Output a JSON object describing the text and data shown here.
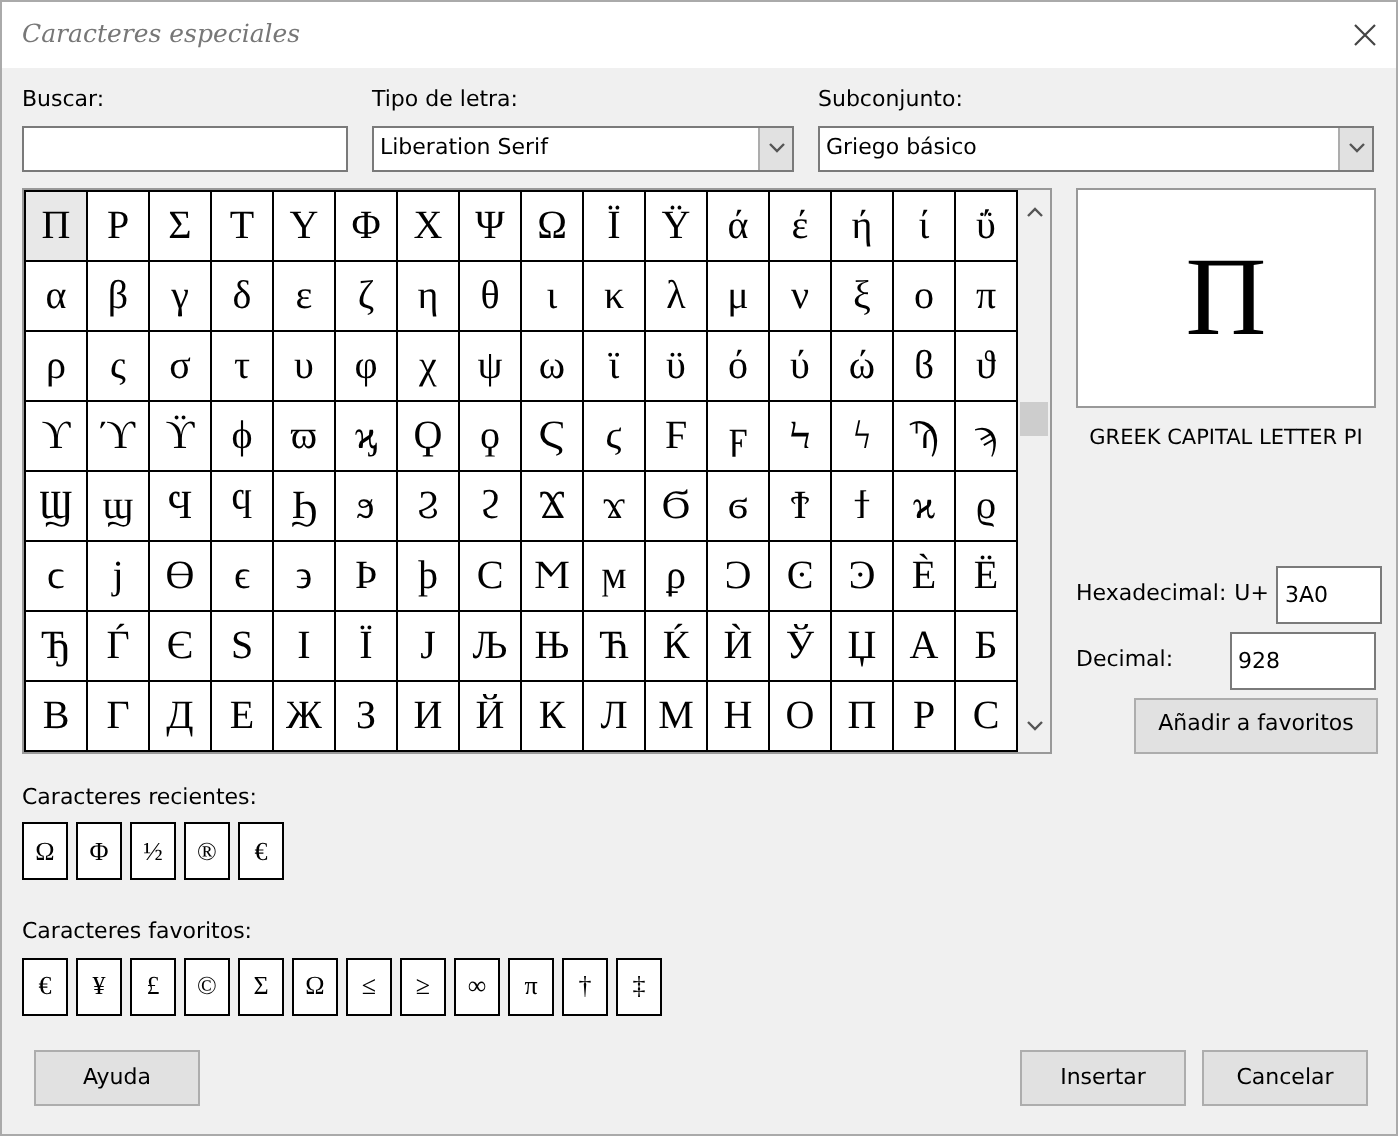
{
  "window": {
    "title": "Caracteres especiales"
  },
  "search": {
    "label": "Buscar:"
  },
  "font": {
    "label": "Tipo de letra:",
    "value": "Liberation Serif"
  },
  "subset": {
    "label": "Subconjunto:",
    "value": "Griego básico"
  },
  "grid": [
    [
      {
        "char": "Π",
        "selected": true
      },
      {
        "char": "Ρ",
        "selected": false
      },
      {
        "char": "Σ",
        "selected": false
      },
      {
        "char": "Τ",
        "selected": false
      },
      {
        "char": "Υ",
        "selected": false
      },
      {
        "char": "Φ",
        "selected": false
      },
      {
        "char": "Χ",
        "selected": false
      },
      {
        "char": "Ψ",
        "selected": false
      },
      {
        "char": "Ω",
        "selected": false
      },
      {
        "char": "Ϊ",
        "selected": false
      },
      {
        "char": "Ϋ",
        "selected": false
      },
      {
        "char": "ά",
        "selected": false
      },
      {
        "char": "έ",
        "selected": false
      },
      {
        "char": "ή",
        "selected": false
      },
      {
        "char": "ί",
        "selected": false
      },
      {
        "char": "ΰ",
        "selected": false
      }
    ],
    [
      {
        "char": "α",
        "selected": false
      },
      {
        "char": "β",
        "selected": false
      },
      {
        "char": "γ",
        "selected": false
      },
      {
        "char": "δ",
        "selected": false
      },
      {
        "char": "ε",
        "selected": false
      },
      {
        "char": "ζ",
        "selected": false
      },
      {
        "char": "η",
        "selected": false
      },
      {
        "char": "θ",
        "selected": false
      },
      {
        "char": "ι",
        "selected": false
      },
      {
        "char": "κ",
        "selected": false
      },
      {
        "char": "λ",
        "selected": false
      },
      {
        "char": "μ",
        "selected": false
      },
      {
        "char": "ν",
        "selected": false
      },
      {
        "char": "ξ",
        "selected": false
      },
      {
        "char": "ο",
        "selected": false
      },
      {
        "char": "π",
        "selected": false
      }
    ],
    [
      {
        "char": "ρ",
        "selected": false
      },
      {
        "char": "ς",
        "selected": false
      },
      {
        "char": "σ",
        "selected": false
      },
      {
        "char": "τ",
        "selected": false
      },
      {
        "char": "υ",
        "selected": false
      },
      {
        "char": "φ",
        "selected": false
      },
      {
        "char": "χ",
        "selected": false
      },
      {
        "char": "ψ",
        "selected": false
      },
      {
        "char": "ω",
        "selected": false
      },
      {
        "char": "ϊ",
        "selected": false
      },
      {
        "char": "ϋ",
        "selected": false
      },
      {
        "char": "ό",
        "selected": false
      },
      {
        "char": "ύ",
        "selected": false
      },
      {
        "char": "ώ",
        "selected": false
      },
      {
        "char": "ϐ",
        "selected": false
      },
      {
        "char": "ϑ",
        "selected": false
      }
    ],
    [
      {
        "char": "ϒ",
        "selected": false
      },
      {
        "char": "ϓ",
        "selected": false
      },
      {
        "char": "ϔ",
        "selected": false
      },
      {
        "char": "ϕ",
        "selected": false
      },
      {
        "char": "ϖ",
        "selected": false
      },
      {
        "char": "ϗ",
        "selected": false
      },
      {
        "char": "Ϙ",
        "selected": false
      },
      {
        "char": "ϙ",
        "selected": false
      },
      {
        "char": "Ϛ",
        "selected": false
      },
      {
        "char": "ϛ",
        "selected": false
      },
      {
        "char": "Ϝ",
        "selected": false
      },
      {
        "char": "ϝ",
        "selected": false
      },
      {
        "char": "Ϟ",
        "selected": false
      },
      {
        "char": "ϟ",
        "selected": false
      },
      {
        "char": "Ϡ",
        "selected": false
      },
      {
        "char": "ϡ",
        "selected": false
      }
    ],
    [
      {
        "char": "Ϣ",
        "selected": false
      },
      {
        "char": "ϣ",
        "selected": false
      },
      {
        "char": "Ϥ",
        "selected": false
      },
      {
        "char": "ϥ",
        "selected": false
      },
      {
        "char": "Ϧ",
        "selected": false
      },
      {
        "char": "ϧ",
        "selected": false
      },
      {
        "char": "Ϩ",
        "selected": false
      },
      {
        "char": "ϩ",
        "selected": false
      },
      {
        "char": "Ϫ",
        "selected": false
      },
      {
        "char": "ϫ",
        "selected": false
      },
      {
        "char": "Ϭ",
        "selected": false
      },
      {
        "char": "ϭ",
        "selected": false
      },
      {
        "char": "Ϯ",
        "selected": false
      },
      {
        "char": "ϯ",
        "selected": false
      },
      {
        "char": "ϰ",
        "selected": false
      },
      {
        "char": "ϱ",
        "selected": false
      }
    ],
    [
      {
        "char": "ϲ",
        "selected": false
      },
      {
        "char": "ϳ",
        "selected": false
      },
      {
        "char": "ϴ",
        "selected": false
      },
      {
        "char": "ϵ",
        "selected": false
      },
      {
        "char": "϶",
        "selected": false
      },
      {
        "char": "Ϸ",
        "selected": false
      },
      {
        "char": "ϸ",
        "selected": false
      },
      {
        "char": "Ϲ",
        "selected": false
      },
      {
        "char": "Ϻ",
        "selected": false
      },
      {
        "char": "ϻ",
        "selected": false
      },
      {
        "char": "ϼ",
        "selected": false
      },
      {
        "char": "Ͻ",
        "selected": false
      },
      {
        "char": "Ͼ",
        "selected": false
      },
      {
        "char": "Ͽ",
        "selected": false
      },
      {
        "char": "Ѐ",
        "selected": false
      },
      {
        "char": "Ё",
        "selected": false
      }
    ],
    [
      {
        "char": "Ђ",
        "selected": false
      },
      {
        "char": "Ѓ",
        "selected": false
      },
      {
        "char": "Є",
        "selected": false
      },
      {
        "char": "Ѕ",
        "selected": false
      },
      {
        "char": "І",
        "selected": false
      },
      {
        "char": "Ї",
        "selected": false
      },
      {
        "char": "Ј",
        "selected": false
      },
      {
        "char": "Љ",
        "selected": false
      },
      {
        "char": "Њ",
        "selected": false
      },
      {
        "char": "Ћ",
        "selected": false
      },
      {
        "char": "Ќ",
        "selected": false
      },
      {
        "char": "Ѝ",
        "selected": false
      },
      {
        "char": "Ў",
        "selected": false
      },
      {
        "char": "Џ",
        "selected": false
      },
      {
        "char": "А",
        "selected": false
      },
      {
        "char": "Б",
        "selected": false
      }
    ],
    [
      {
        "char": "В",
        "selected": false
      },
      {
        "char": "Г",
        "selected": false
      },
      {
        "char": "Д",
        "selected": false
      },
      {
        "char": "Е",
        "selected": false
      },
      {
        "char": "Ж",
        "selected": false
      },
      {
        "char": "З",
        "selected": false
      },
      {
        "char": "И",
        "selected": false
      },
      {
        "char": "Й",
        "selected": false
      },
      {
        "char": "К",
        "selected": false
      },
      {
        "char": "Л",
        "selected": false
      },
      {
        "char": "М",
        "selected": false
      },
      {
        "char": "Н",
        "selected": false
      },
      {
        "char": "О",
        "selected": false
      },
      {
        "char": "П",
        "selected": false
      },
      {
        "char": "Р",
        "selected": false
      },
      {
        "char": "С",
        "selected": false
      }
    ]
  ],
  "preview": {
    "char": "Π",
    "name": "GREEK CAPITAL LETTER PI"
  },
  "hex": {
    "label": "Hexadecimal:",
    "prefix": "U+",
    "value": "3A0"
  },
  "decimal": {
    "label": "Decimal:",
    "value": "928"
  },
  "add_favorite_button": "Añadir a favoritos",
  "recent": {
    "label": "Caracteres recientes:",
    "chars": [
      "Ω",
      "Φ",
      "½",
      "®",
      "€"
    ]
  },
  "favorites": {
    "label": "Caracteres favoritos:",
    "chars": [
      "€",
      "¥",
      "£",
      "©",
      "Σ",
      "Ω",
      "≤",
      "≥",
      "∞",
      "π",
      "†",
      "‡"
    ]
  },
  "buttons": {
    "help": "Ayuda",
    "insert": "Insertar",
    "cancel": "Cancelar"
  }
}
